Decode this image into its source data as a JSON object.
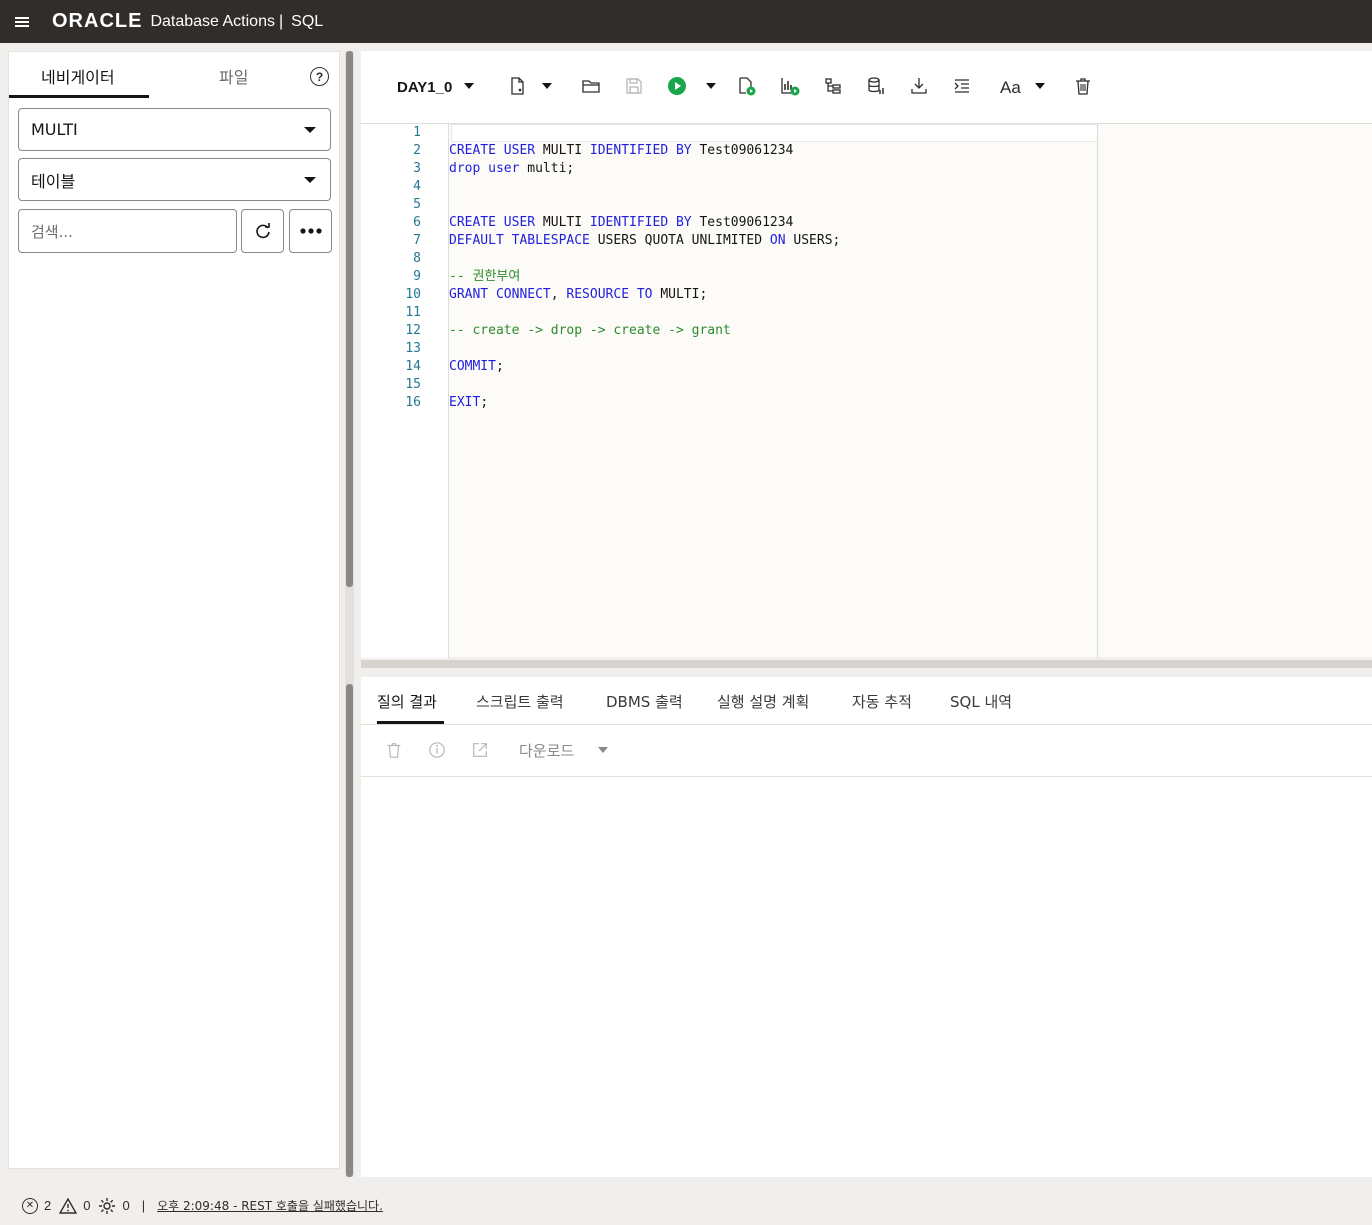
{
  "topbar": {
    "brand": "ORACLE",
    "product": "Database Actions",
    "separator": "|",
    "section": "SQL"
  },
  "left_panel": {
    "tabs": [
      "네비게이터",
      "파일"
    ],
    "help": "?",
    "schema_select": "MULTI",
    "object_type_select": "테이블",
    "search_placeholder": "검색..."
  },
  "editor": {
    "worksheet_name": "DAY1_0",
    "font_button": "Aa",
    "line_numbers": [
      "1",
      "2",
      "3",
      "4",
      "5",
      "6",
      "7",
      "8",
      "9",
      "10",
      "11",
      "12",
      "13",
      "14",
      "15",
      "16"
    ],
    "code": [
      [],
      [
        [
          "CREATE USER",
          "kw"
        ],
        [
          " MULTI ",
          ""
        ],
        [
          "IDENTIFIED BY",
          "kw"
        ],
        [
          " Test09061234",
          ""
        ]
      ],
      [
        [
          "drop user",
          "kw"
        ],
        [
          " multi;",
          ""
        ]
      ],
      [],
      [],
      [
        [
          "CREATE USER",
          "kw"
        ],
        [
          " MULTI ",
          ""
        ],
        [
          "IDENTIFIED BY",
          "kw"
        ],
        [
          " Test09061234",
          ""
        ]
      ],
      [
        [
          "DEFAULT TABLESPACE",
          "kw"
        ],
        [
          " USERS QUOTA UNLIMITED ",
          ""
        ],
        [
          "ON",
          "kw"
        ],
        [
          " USERS;",
          ""
        ]
      ],
      [],
      [
        [
          "-- 권한부여",
          "cm"
        ]
      ],
      [
        [
          "GRANT CONNECT",
          "kw"
        ],
        [
          ", ",
          ""
        ],
        [
          "RESOURCE TO",
          "kw"
        ],
        [
          " MULTI;",
          ""
        ]
      ],
      [],
      [
        [
          "-- create -> drop -> create -> grant",
          "cm"
        ]
      ],
      [],
      [
        [
          "COMMIT",
          "kw"
        ],
        [
          ";",
          ""
        ]
      ],
      [],
      [
        [
          "EXIT",
          "kw"
        ],
        [
          ";",
          ""
        ]
      ]
    ]
  },
  "results": {
    "tabs": [
      "질의 결과",
      "스크립트 출력",
      "DBMS 출력",
      "실행 설명 계획",
      "자동 추적",
      "SQL 내역"
    ],
    "download_label": "다운로드"
  },
  "statusbar": {
    "errors": "2",
    "warnings": "0",
    "tasks": "0",
    "divider": "|",
    "message": "오후 2:09:48 - REST 호출을 실패했습니다."
  },
  "colors": {
    "topbar_bg": "#312d2a",
    "keyword": "#1f1fdd",
    "comment": "#2e8b2e",
    "run_green": "#1aa64a"
  }
}
